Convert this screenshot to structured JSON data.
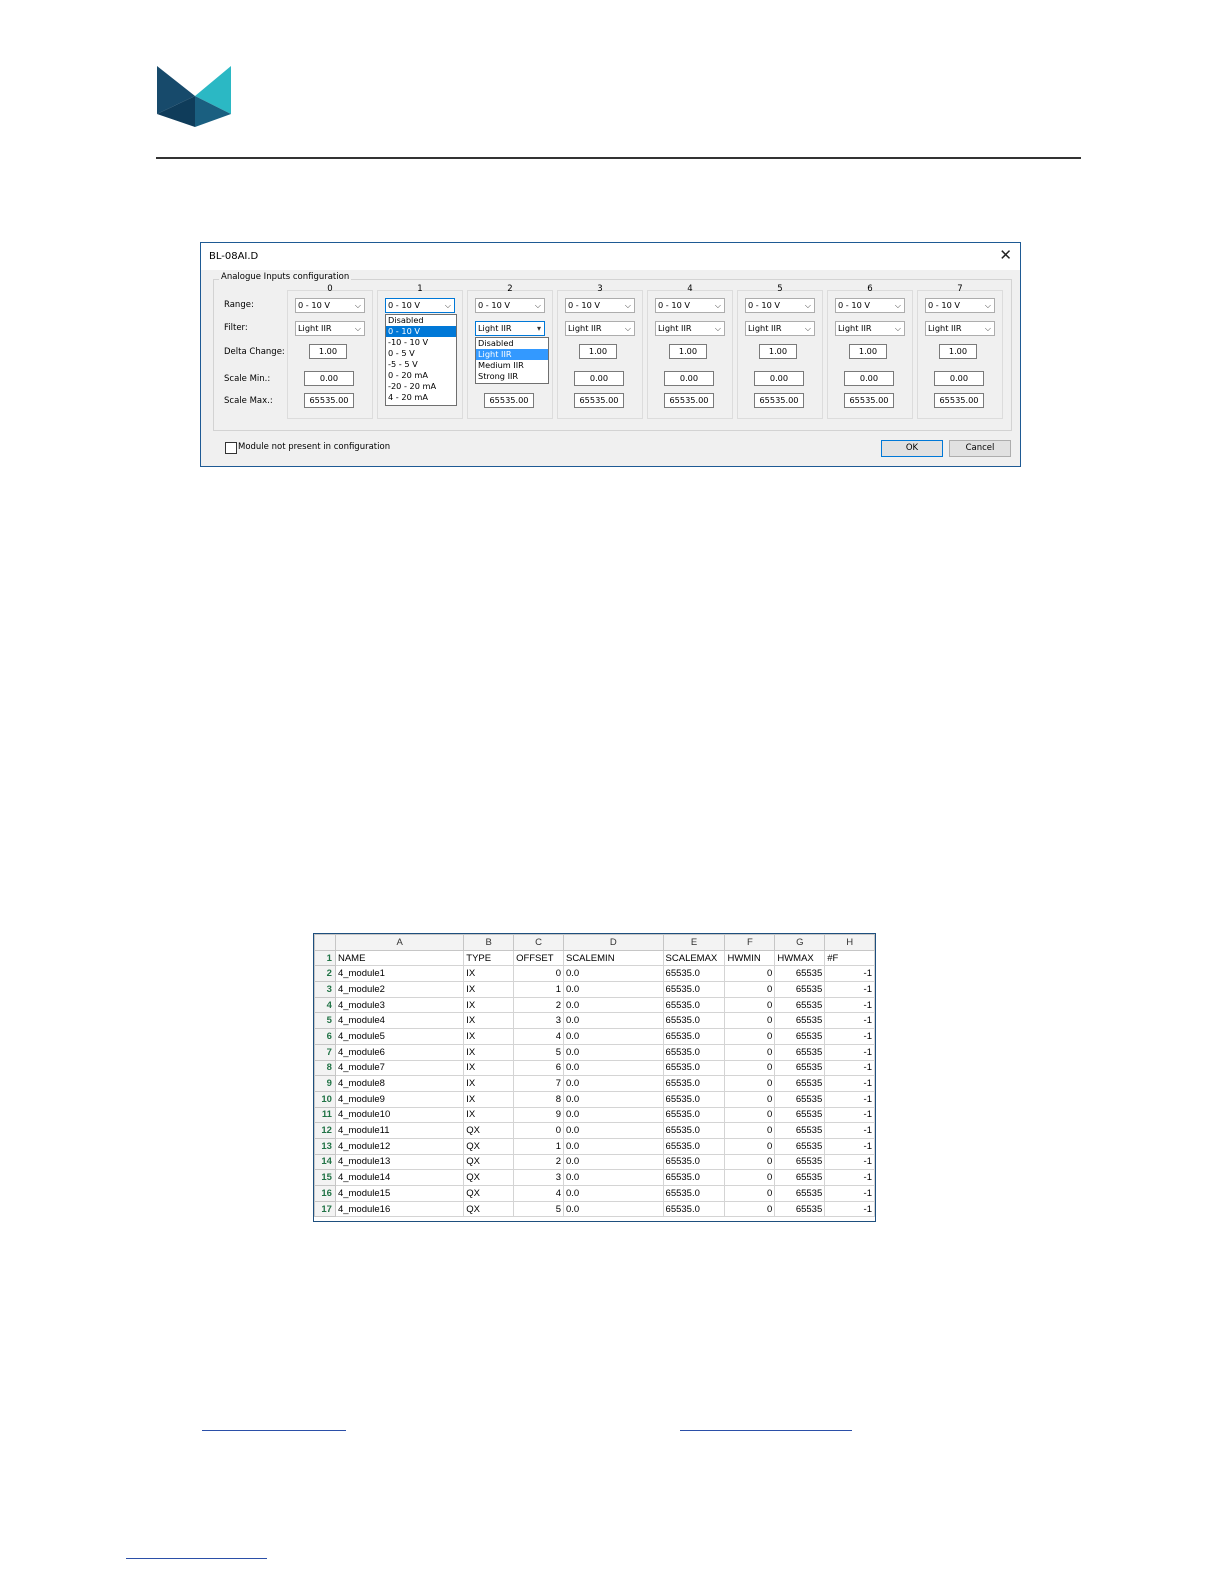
{
  "brand": {
    "logo_icon": "triangles-logo-icon"
  },
  "dialog": {
    "title": "BL-08AI.D",
    "group_label": "Analogue Inputs configuration",
    "row_labels": {
      "range": "Range:",
      "filter": "Filter:",
      "delta": "Delta Change:",
      "scale_min": "Scale Min.:",
      "scale_max": "Scale Max.:"
    },
    "channels": [
      {
        "header": "0",
        "range": "0 - 10 V",
        "filter": "Light IIR",
        "delta": "1.00",
        "scale_min": "0.00",
        "scale_max": "65535.00"
      },
      {
        "header": "1",
        "range": "0 - 10 V",
        "filter": "",
        "delta": "",
        "scale_min": "",
        "scale_max": ""
      },
      {
        "header": "2",
        "range": "0 - 10 V",
        "filter": "Light IIR",
        "delta": "",
        "scale_min": "",
        "scale_max": "65535.00"
      },
      {
        "header": "3",
        "range": "0 - 10 V",
        "filter": "Light IIR",
        "delta": "1.00",
        "scale_min": "0.00",
        "scale_max": "65535.00"
      },
      {
        "header": "4",
        "range": "0 - 10 V",
        "filter": "Light IIR",
        "delta": "1.00",
        "scale_min": "0.00",
        "scale_max": "65535.00"
      },
      {
        "header": "5",
        "range": "0 - 10 V",
        "filter": "Light IIR",
        "delta": "1.00",
        "scale_min": "0.00",
        "scale_max": "65535.00"
      },
      {
        "header": "6",
        "range": "0 - 10 V",
        "filter": "Light IIR",
        "delta": "1.00",
        "scale_min": "0.00",
        "scale_max": "65535.00"
      },
      {
        "header": "7",
        "range": "0 - 10 V",
        "filter": "Light IIR",
        "delta": "1.00",
        "scale_min": "0.00",
        "scale_max": "65535.00"
      }
    ],
    "range_dropdown": {
      "options": [
        "Disabled",
        "0 - 10 V",
        "-10 - 10 V",
        "0 - 5 V",
        "-5 - 5 V",
        "0 - 20 mA",
        "-20 - 20 mA",
        "4 - 20 mA"
      ],
      "selected": "0 - 10 V"
    },
    "filter_dropdown": {
      "options": [
        "Disabled",
        "Light IIR",
        "Medium IIR",
        "Strong IIR"
      ],
      "selected": "Light IIR"
    },
    "checkbox_label": "Module not present in configuration",
    "ok_label": "OK",
    "cancel_label": "Cancel",
    "close_icon": "close-icon"
  },
  "spreadsheet": {
    "columns": [
      "A",
      "B",
      "C",
      "D",
      "E",
      "F",
      "G",
      "H"
    ],
    "rows": [
      [
        "1",
        "NAME",
        "TYPE",
        "OFFSET",
        "SCALEMIN",
        "SCALEMAX",
        "HWMIN",
        "HWMAX",
        "#F"
      ],
      [
        "2",
        "4_module1",
        "IX",
        "0",
        "0.0",
        "65535.0",
        "0",
        "65535",
        "-1"
      ],
      [
        "3",
        "4_module2",
        "IX",
        "1",
        "0.0",
        "65535.0",
        "0",
        "65535",
        "-1"
      ],
      [
        "4",
        "4_module3",
        "IX",
        "2",
        "0.0",
        "65535.0",
        "0",
        "65535",
        "-1"
      ],
      [
        "5",
        "4_module4",
        "IX",
        "3",
        "0.0",
        "65535.0",
        "0",
        "65535",
        "-1"
      ],
      [
        "6",
        "4_module5",
        "IX",
        "4",
        "0.0",
        "65535.0",
        "0",
        "65535",
        "-1"
      ],
      [
        "7",
        "4_module6",
        "IX",
        "5",
        "0.0",
        "65535.0",
        "0",
        "65535",
        "-1"
      ],
      [
        "8",
        "4_module7",
        "IX",
        "6",
        "0.0",
        "65535.0",
        "0",
        "65535",
        "-1"
      ],
      [
        "9",
        "4_module8",
        "IX",
        "7",
        "0.0",
        "65535.0",
        "0",
        "65535",
        "-1"
      ],
      [
        "10",
        "4_module9",
        "IX",
        "8",
        "0.0",
        "65535.0",
        "0",
        "65535",
        "-1"
      ],
      [
        "11",
        "4_module10",
        "IX",
        "9",
        "0.0",
        "65535.0",
        "0",
        "65535",
        "-1"
      ],
      [
        "12",
        "4_module11",
        "QX",
        "0",
        "0.0",
        "65535.0",
        "0",
        "65535",
        "-1"
      ],
      [
        "13",
        "4_module12",
        "QX",
        "1",
        "0.0",
        "65535.0",
        "0",
        "65535",
        "-1"
      ],
      [
        "14",
        "4_module13",
        "QX",
        "2",
        "0.0",
        "65535.0",
        "0",
        "65535",
        "-1"
      ],
      [
        "15",
        "4_module14",
        "QX",
        "3",
        "0.0",
        "65535.0",
        "0",
        "65535",
        "-1"
      ],
      [
        "16",
        "4_module15",
        "QX",
        "4",
        "0.0",
        "65535.0",
        "0",
        "65535",
        "-1"
      ],
      [
        "17",
        "4_module16",
        "QX",
        "5",
        "0.0",
        "65535.0",
        "0",
        "65535",
        "-1"
      ]
    ]
  }
}
